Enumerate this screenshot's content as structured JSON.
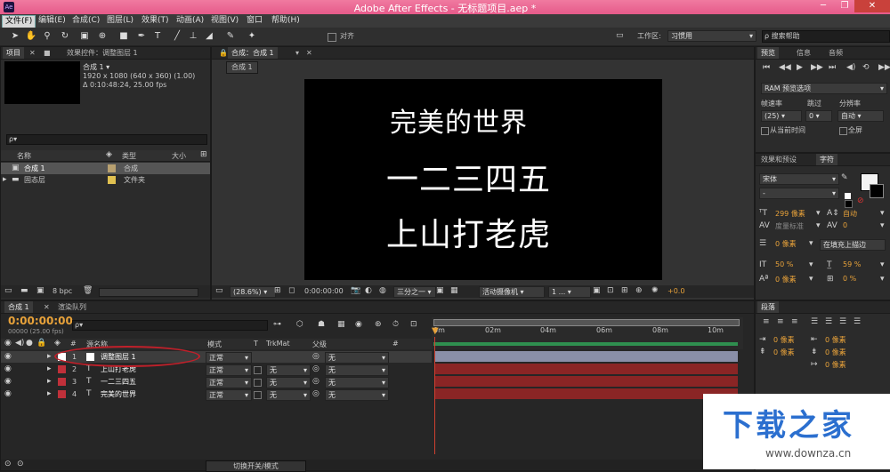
{
  "window": {
    "title": "Adobe After Effects - 无标题项目.aep *",
    "app_icon": "Ae"
  },
  "menubar": [
    "文件(F)",
    "编辑(E)",
    "合成(C)",
    "图层(L)",
    "效果(T)",
    "动画(A)",
    "视图(V)",
    "窗口",
    "帮助(H)"
  ],
  "toolbar": {
    "snap_label": "对齐",
    "workspace_label": "工作区:",
    "workspace_value": "习惯用",
    "search_placeholder": "搜索帮助"
  },
  "project_panel": {
    "tab_project": "项目",
    "tab_effects": "效果控件：调整图层 1",
    "comp_name": "合成 1 ▾",
    "comp_info1": "1920 x 1080  (640 x 360) (1.00)",
    "comp_info2": "Δ 0:10:48:24, 25.00 fps",
    "search_placeholder": "ρ▾",
    "col_name": "名称",
    "col_type": "类型",
    "col_size": "大小",
    "items": [
      {
        "name": "合成 1",
        "type": "合成",
        "color": "#b8a070"
      },
      {
        "name": "固态层",
        "type": "文件夹",
        "color": "#e0c050"
      }
    ],
    "bpc": "8 bpc"
  },
  "comp_viewer": {
    "tab": "合成：合成 1",
    "subtab": "合成 1",
    "lines": [
      "完美的世界",
      "一二三四五",
      "上山打老虎"
    ],
    "zoom": "(28.6%)",
    "timecode": "0:00:00:00",
    "resolution": "三分之一",
    "camera": "活动摄像机",
    "views": "1 ...",
    "exposure": "+0.0"
  },
  "preview_panel": {
    "tabs": [
      "预览",
      "信息",
      "音频"
    ],
    "ram_label": "RAM 预览选项",
    "frame_rate_label": "帧速率",
    "skip_label": "跳过",
    "resolution_label": "分辨率",
    "frame_rate_value": "(25)",
    "skip_value": "0",
    "resolution_value": "自动",
    "from_current": "从当前时间",
    "fullscreen": "全屏"
  },
  "character_panel": {
    "tabs": [
      "效果和预设",
      "字符"
    ],
    "font": "宋体",
    "style": "-",
    "size": "299 像素",
    "leading": "自动",
    "kerning": "度量标准",
    "tracking": "0",
    "stroke_width": "0 像素",
    "stroke_type": "在填充上描边",
    "vscale": "50 %",
    "hscale": "59 %",
    "baseline": "0 像素",
    "tsume": "0 %"
  },
  "paragraph_panel": {
    "tab": "段落",
    "values": [
      "0 像素",
      "0 像素",
      "0 像素",
      "0 像素",
      "0 像素"
    ]
  },
  "timeline": {
    "tab_comp": "合成 1",
    "tab_render": "渲染队列",
    "timecode": "0:00:00:00",
    "frames": "00000 (25.00 fps)",
    "col_source": "源名称",
    "col_mode": "模式",
    "col_t": "T",
    "col_trkmat": "TrkMat",
    "col_parent": "父级",
    "col_hash": "#",
    "ruler": [
      "0m",
      "02m",
      "04m",
      "06m",
      "08m",
      "10m"
    ],
    "layers": [
      {
        "num": "1",
        "name": "调整图层 1",
        "mode": "正常",
        "trkmat": "",
        "parent": "无",
        "color": "#ffffff"
      },
      {
        "num": "2",
        "name": "上山打老虎",
        "mode": "正常",
        "trkmat": "无",
        "parent": "无",
        "color": "#c0303a"
      },
      {
        "num": "3",
        "name": "一二三四五",
        "mode": "正常",
        "trkmat": "无",
        "parent": "无",
        "color": "#c0303a"
      },
      {
        "num": "4",
        "name": "完美的世界",
        "mode": "正常",
        "trkmat": "无",
        "parent": "无",
        "color": "#c0303a"
      }
    ],
    "toggle_label": "切换开关/模式"
  },
  "watermark": {
    "brand": "下载之家",
    "url": "www.downza.cn"
  }
}
